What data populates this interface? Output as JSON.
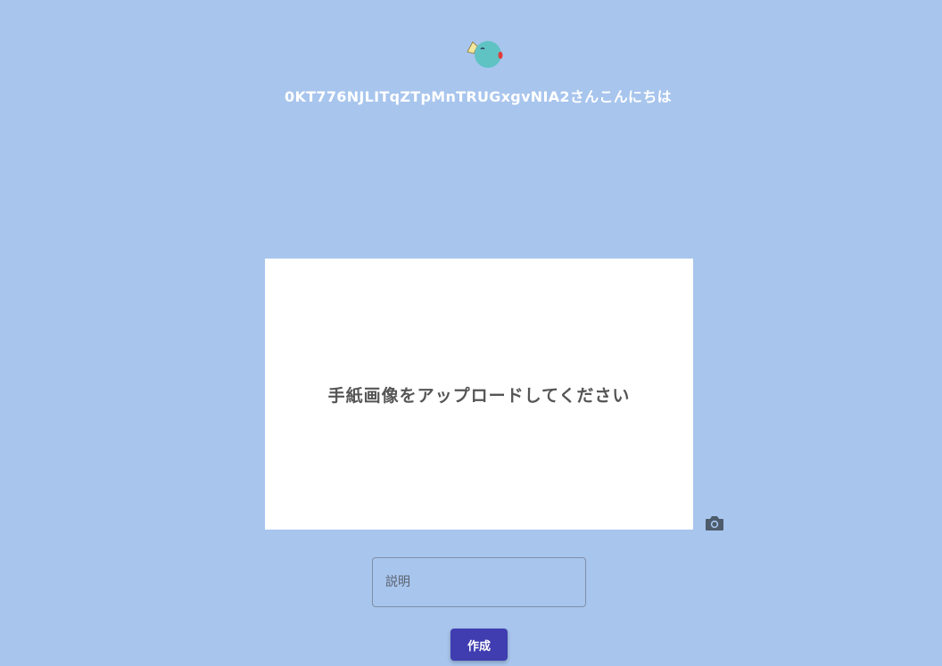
{
  "header": {
    "mascot_icon": "bird-mascot-icon",
    "greeting": "0KT776NJLITqZTpMnTRUGxgvNIA2さんこんにちは"
  },
  "upload": {
    "prompt": "手紙画像をアップロードしてください",
    "camera_icon": "camera-icon"
  },
  "form": {
    "description_placeholder": "説明",
    "description_value": "",
    "create_label": "作成"
  },
  "colors": {
    "background": "#a8c5ed",
    "button": "#3f3db0",
    "upload_bg": "#ffffff"
  }
}
